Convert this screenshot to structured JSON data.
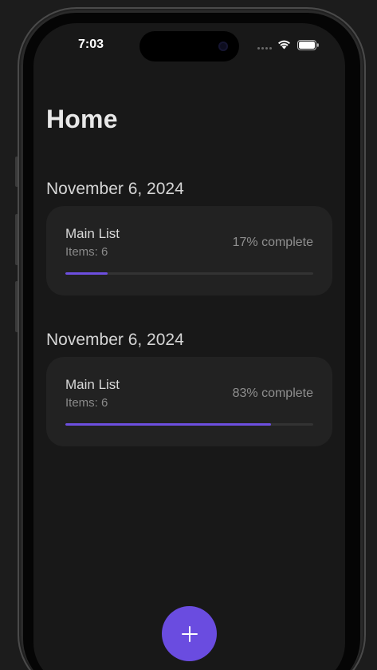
{
  "status_bar": {
    "time": "7:03",
    "icons": [
      "cellular-dots-icon",
      "wifi-icon",
      "battery-icon"
    ]
  },
  "home": {
    "title": "Home",
    "sections": [
      {
        "date": "November 6, 2024",
        "card": {
          "name": "Main List",
          "items_text": "Items: 6",
          "progress_text": "17% complete",
          "progress": 0.17
        }
      },
      {
        "date": "November 6, 2024",
        "card": {
          "name": "Main List",
          "items_text": "Items: 6",
          "progress_text": "83% complete",
          "progress": 0.83
        }
      }
    ]
  },
  "fab": {
    "icon": "plus-icon"
  },
  "colors": {
    "accent": "#6a4ce0",
    "background": "#181818",
    "card": "#222222"
  }
}
